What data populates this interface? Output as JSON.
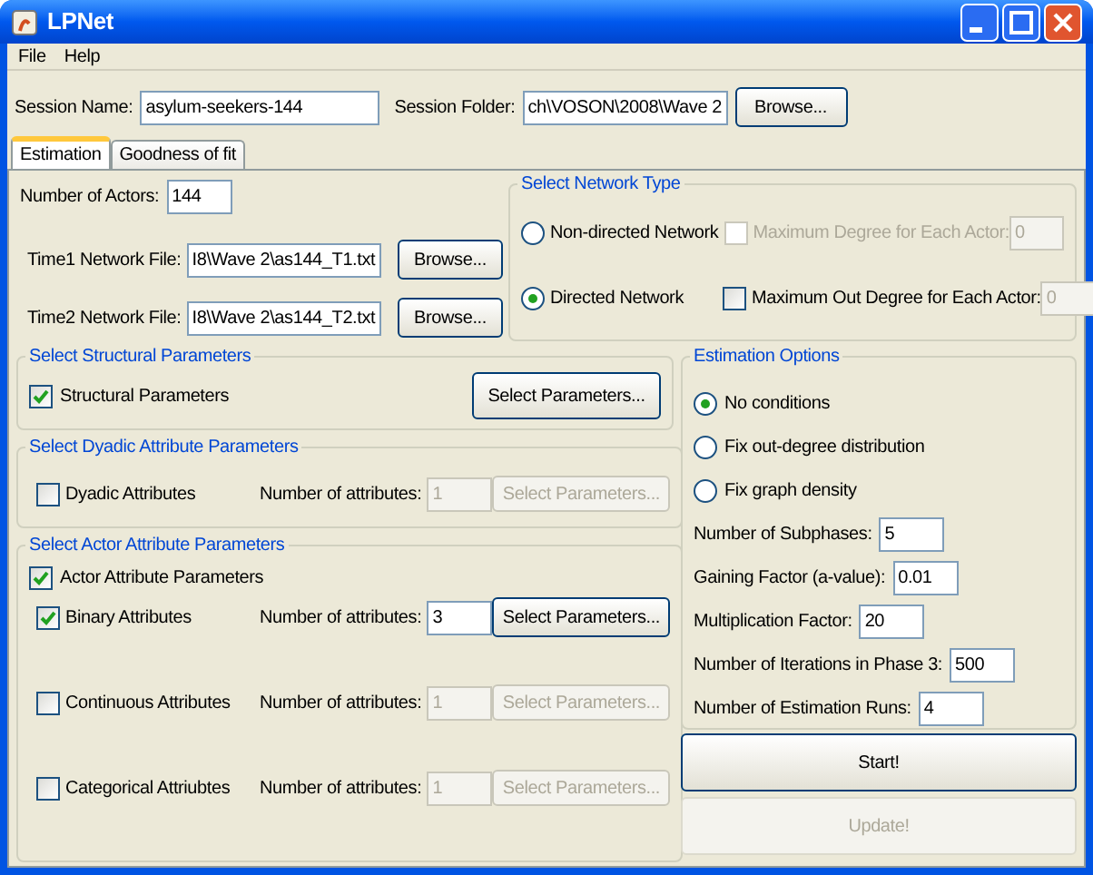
{
  "window": {
    "title": "LPNet"
  },
  "menu": [
    "File",
    "Help"
  ],
  "session": {
    "name_label": "Session Name:",
    "name_value": "asylum-seekers-144",
    "folder_label": "Session Folder:",
    "folder_value": "ch\\VOSON\\2008\\Wave 2",
    "browse": "Browse..."
  },
  "tabs": [
    {
      "label": "Estimation",
      "selected": true
    },
    {
      "label": "Goodness of fit",
      "selected": false
    }
  ],
  "actors": {
    "label": "Number of Actors:",
    "value": "144"
  },
  "network_files": [
    {
      "label": "Time1 Network File:",
      "value": "I8\\Wave 2\\as144_T1.txt",
      "button": "Browse..."
    },
    {
      "label": "Time2 Network File:",
      "value": "I8\\Wave 2\\as144_T2.txt",
      "button": "Browse..."
    }
  ],
  "network_type": {
    "title": "Select Network Type",
    "options": [
      {
        "label": "Non-directed Network",
        "selected": false,
        "max_label": "Maximum Degree for Each Actor:",
        "max_checked": false,
        "max_disabled": true,
        "max_value": "0"
      },
      {
        "label": "Directed Network",
        "selected": true,
        "max_label": "Maximum Out Degree for Each Actor:",
        "max_checked": false,
        "max_disabled": false,
        "max_value": "0"
      }
    ]
  },
  "structural": {
    "title": "Select Structural Parameters",
    "label": "Structural Parameters",
    "checked": true,
    "button": "Select Parameters..."
  },
  "dyadic": {
    "title": "Select Dyadic Attribute Parameters",
    "rows": [
      {
        "label": "Dyadic Attributes",
        "checked": false,
        "count_label": "Number of attributes:",
        "count": "1",
        "disabled": true,
        "button": "Select Parameters..."
      }
    ]
  },
  "actor": {
    "title": "Select Actor Attribute Parameters",
    "label": "Actor Attribute Parameters",
    "checked": true,
    "rows": [
      {
        "label": "Binary Attributes",
        "checked": true,
        "count_label": "Number of attributes:",
        "count": "3",
        "disabled": false,
        "button": "Select Parameters..."
      },
      {
        "label": "Continuous Attributes",
        "checked": false,
        "count_label": "Number of attributes:",
        "count": "1",
        "disabled": true,
        "button": "Select Parameters..."
      },
      {
        "label": "Categorical Attriubtes",
        "checked": false,
        "count_label": "Number of attributes:",
        "count": "1",
        "disabled": true,
        "button": "Select Parameters..."
      }
    ]
  },
  "estimation": {
    "title": "Estimation Options",
    "options": [
      {
        "label": "No conditions",
        "selected": true
      },
      {
        "label": "Fix out-degree distribution",
        "selected": false
      },
      {
        "label": "Fix graph density",
        "selected": false
      }
    ],
    "fields": [
      {
        "label": "Number of Subphases:",
        "value": "5"
      },
      {
        "label": "Gaining Factor (a-value):",
        "value": "0.01"
      },
      {
        "label": "Multiplication Factor:",
        "value": "20"
      },
      {
        "label": "Number of Iterations in Phase 3:",
        "value": "500"
      },
      {
        "label": "Number of Estimation Runs:",
        "value": "4"
      }
    ]
  },
  "actions": [
    {
      "label": "Start!",
      "disabled": false
    },
    {
      "label": "Update!",
      "disabled": true
    }
  ]
}
